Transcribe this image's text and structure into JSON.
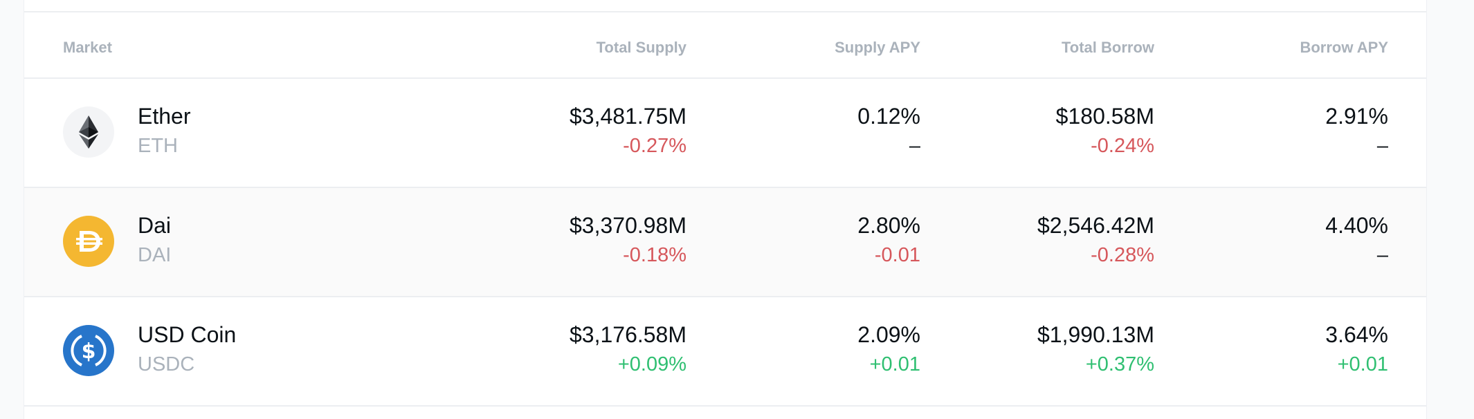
{
  "colors": {
    "negative": "#d6575b",
    "positive": "#2fbf71",
    "neutral": "#0b1116"
  },
  "table": {
    "headers": {
      "market": "Market",
      "total_supply": "Total Supply",
      "supply_apy": "Supply APY",
      "total_borrow": "Total Borrow",
      "borrow_apy": "Borrow APY"
    },
    "rows": [
      {
        "name": "Ether",
        "symbol": "ETH",
        "icon": "ethereum-icon",
        "total_supply": "$3,481.75M",
        "total_supply_change": "-0.27%",
        "supply_apy": "0.12%",
        "supply_apy_change": "–",
        "total_borrow": "$180.58M",
        "total_borrow_change": "-0.24%",
        "borrow_apy": "2.91%",
        "borrow_apy_change": "–"
      },
      {
        "name": "Dai",
        "symbol": "DAI",
        "icon": "dai-icon",
        "total_supply": "$3,370.98M",
        "total_supply_change": "-0.18%",
        "supply_apy": "2.80%",
        "supply_apy_change": "-0.01",
        "total_borrow": "$2,546.42M",
        "total_borrow_change": "-0.28%",
        "borrow_apy": "4.40%",
        "borrow_apy_change": "–"
      },
      {
        "name": "USD Coin",
        "symbol": "USDC",
        "icon": "usdc-icon",
        "total_supply": "$3,176.58M",
        "total_supply_change": "+0.09%",
        "supply_apy": "2.09%",
        "supply_apy_change": "+0.01",
        "total_borrow": "$1,990.13M",
        "total_borrow_change": "+0.37%",
        "borrow_apy": "3.64%",
        "borrow_apy_change": "+0.01"
      }
    ]
  }
}
